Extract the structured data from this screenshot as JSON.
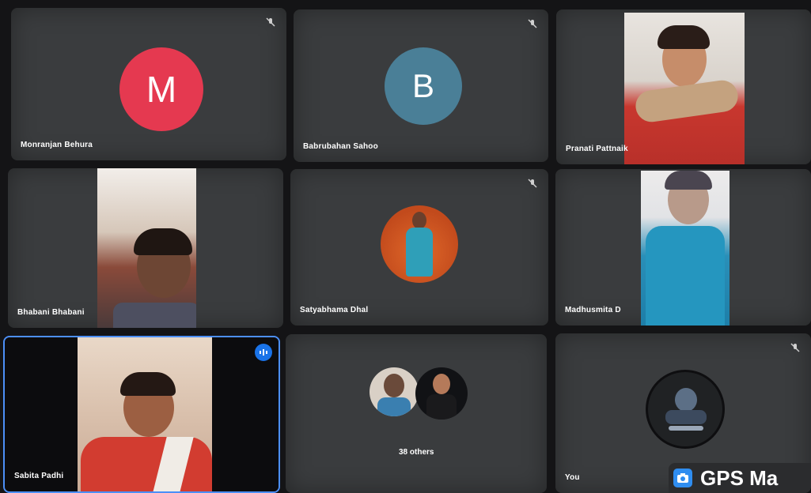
{
  "participants": [
    {
      "name": "Monranjan Behura",
      "initial": "M",
      "avatar_color": "#e53950",
      "muted": true
    },
    {
      "name": "Babrubahan Sahoo",
      "initial": "B",
      "avatar_color": "#4a7f97",
      "muted": true
    },
    {
      "name": "Pranati Pattnaik",
      "video": true
    },
    {
      "name": "Bhabani Bhabani",
      "video": true
    },
    {
      "name": "Satyabhama Dhal",
      "photo_avatar": true,
      "muted": true
    },
    {
      "name": "Madhusmita D",
      "video": true
    },
    {
      "name": "Sabita Padhi",
      "video": true,
      "speaking": true
    },
    {
      "name": "You",
      "photo_avatar": true,
      "muted": true
    }
  ],
  "others": {
    "label": "38 others"
  },
  "gps_badge": {
    "text": "GPS Ma"
  },
  "colors": {
    "active_border": "#4c8ff7",
    "tile_bg": "#3a3c3e",
    "accent": "#1a73e8"
  }
}
